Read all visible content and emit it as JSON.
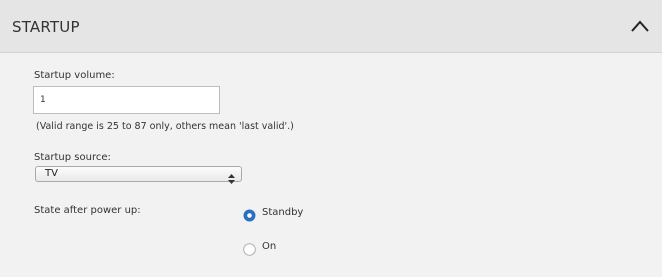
{
  "section": {
    "title": "STARTUP",
    "collapse_icon": "chevron-up-icon"
  },
  "startup_volume": {
    "label": "Startup volume:",
    "value": "1",
    "hint": "(Valid range is 25 to 87 only, others mean 'last valid'.)"
  },
  "startup_source": {
    "label": "Startup source:",
    "selected": "TV"
  },
  "power_up_state": {
    "label": "State after power up:",
    "options": [
      {
        "label": "Standby",
        "selected": true
      },
      {
        "label": "On",
        "selected": false
      }
    ]
  },
  "colors": {
    "accent": "#2a6fc4",
    "header_bg": "#e5e5e5",
    "panel_bg": "#f2f2f2"
  }
}
